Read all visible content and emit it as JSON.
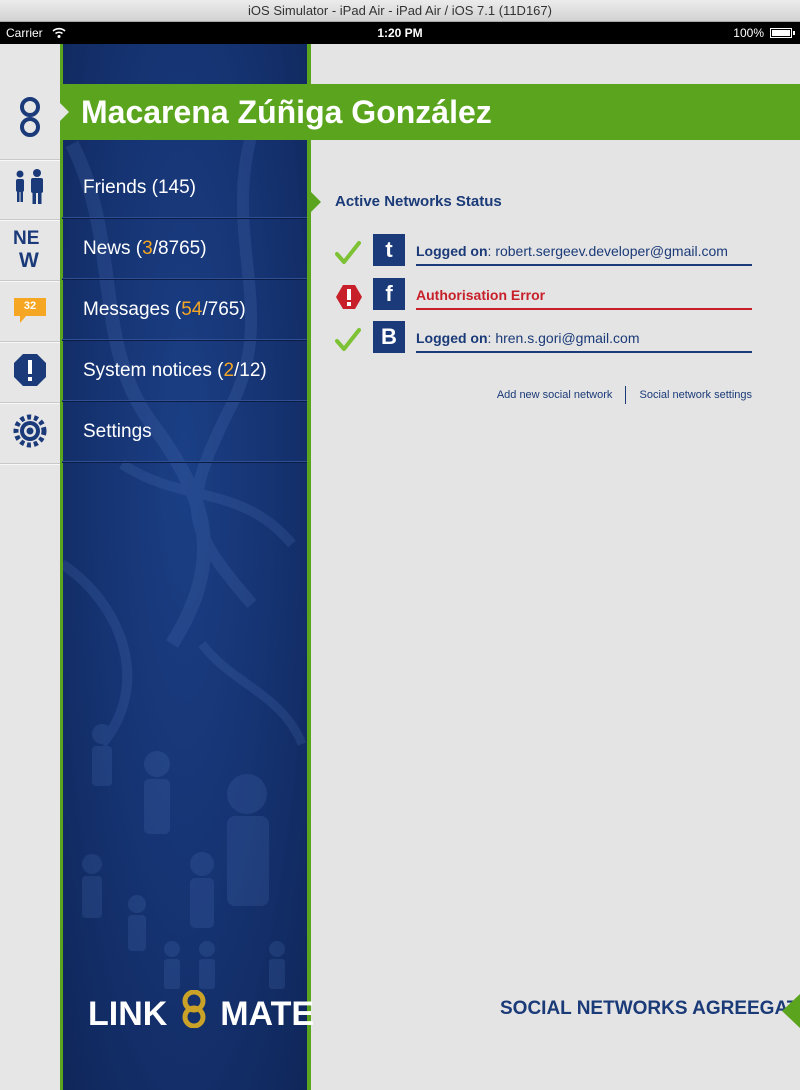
{
  "window": {
    "title": "iOS Simulator - iPad Air - iPad Air / iOS 7.1 (11D167)"
  },
  "statusbar": {
    "carrier": "Carrier",
    "time": "1:20 PM",
    "battery": "100%"
  },
  "profile": {
    "name": "Macarena Zúñiga González"
  },
  "nav": [
    {
      "label": "Friends (",
      "count": "145",
      "suffix": ")",
      "icon": "friends-icon"
    },
    {
      "label": "News (",
      "highlight": "3",
      "rest": "/8765)",
      "icon": "new-icon"
    },
    {
      "label": "Messages (",
      "highlight": "54",
      "rest": "/765)",
      "icon": "messages-icon",
      "badge": "32"
    },
    {
      "label": "System notices (",
      "highlight": "2",
      "rest": "/12)",
      "icon": "alert-icon"
    },
    {
      "label": "Settings",
      "icon": "gear-icon"
    }
  ],
  "content": {
    "section_title": "Active Networks Status",
    "networks": [
      {
        "logo": "t",
        "status": "ok",
        "prefix": "Logged on",
        "value": ": robert.sergeev.developer@gmail.com"
      },
      {
        "logo": "f",
        "status": "error",
        "message": "Authorisation Error"
      },
      {
        "logo": "B",
        "status": "ok",
        "prefix": "Logged on",
        "value": ": hren.s.gori@gmail.com"
      }
    ],
    "links": {
      "add": "Add new social network",
      "settings": "Social network settings"
    }
  },
  "branding": {
    "logo_left": "LINK",
    "logo_right": "MATE",
    "tagline": "SOCIAL NETWORKS AGREEGATOR"
  },
  "colors": {
    "green": "#5aa51d",
    "navy": "#1a3a78",
    "orange": "#f5a623",
    "error": "#c8202a"
  }
}
